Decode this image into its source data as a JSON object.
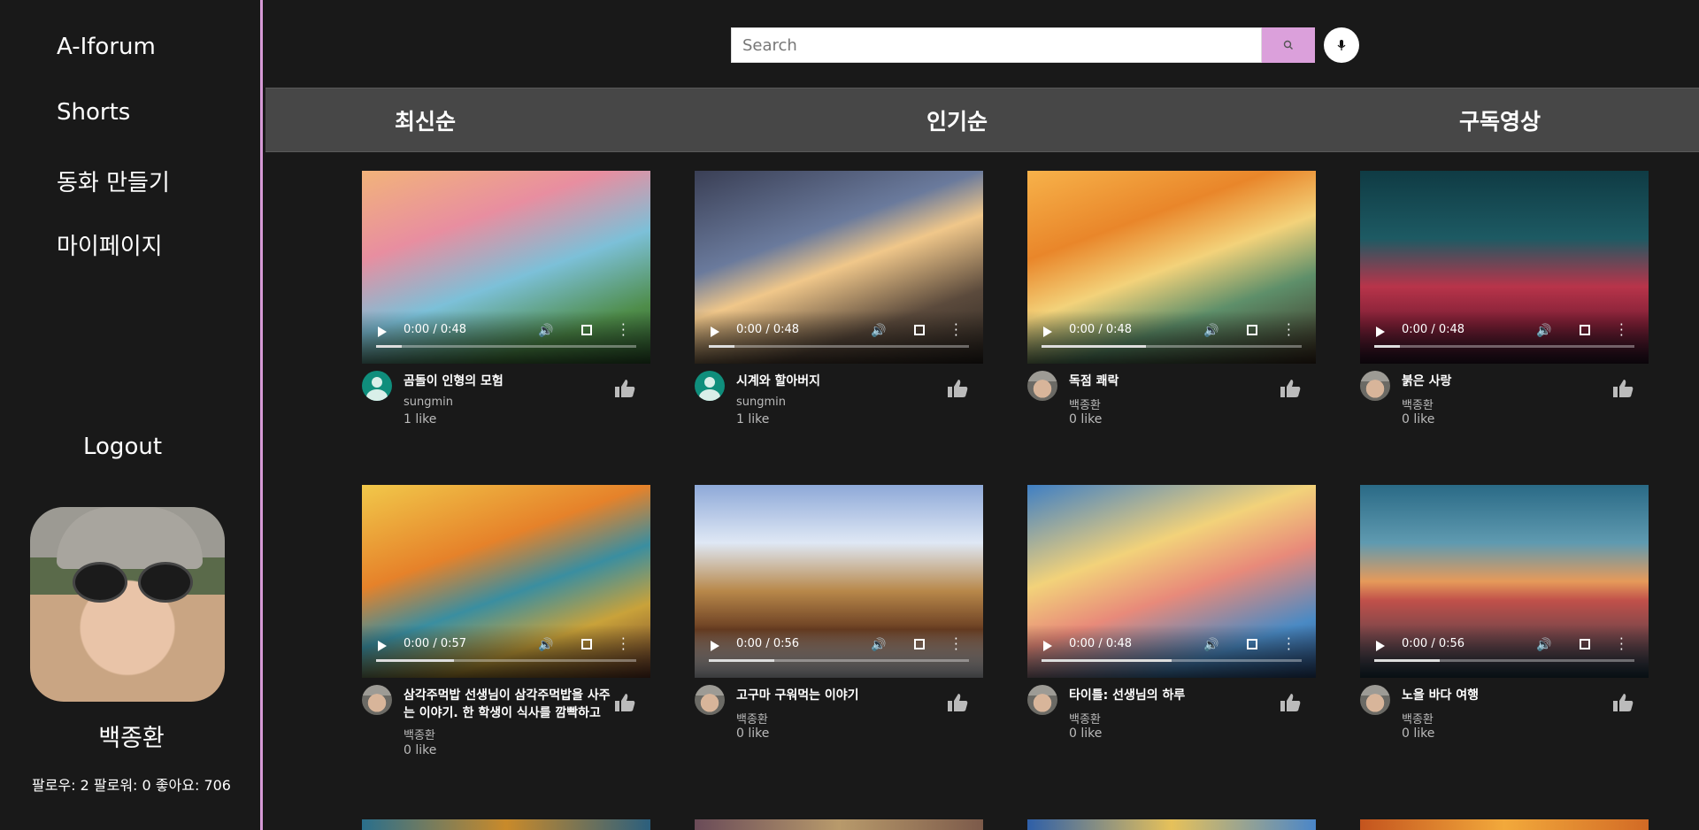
{
  "sidebar": {
    "items": [
      {
        "label": "A-Iforum"
      },
      {
        "label": "Shorts"
      },
      {
        "label": "동화 만들기"
      },
      {
        "label": "마이페이지"
      }
    ],
    "logout_label": "Logout",
    "user_name": "백종환",
    "user_stats": "팔로우: 2 팔로워: 0 좋아요: 706"
  },
  "search": {
    "placeholder": "Search",
    "search_icon": "search-icon",
    "mic_icon": "microphone-icon"
  },
  "tabs": [
    {
      "label": "최신순"
    },
    {
      "label": "인기순"
    },
    {
      "label": "구독영상"
    }
  ],
  "colors": {
    "accent": "#dba0db",
    "tab_bar": "#474747",
    "background": "#191919"
  },
  "videos": [
    {
      "title": "곰돌이 인형의 모험",
      "author": "sungmin",
      "likes": "1 like",
      "time": "0:00 / 0:48",
      "progress": 0.1
    },
    {
      "title": "시계와 할아버지",
      "author": "sungmin",
      "likes": "1 like",
      "time": "0:00 / 0:48",
      "progress": 0.1
    },
    {
      "title": "독점 쾌락",
      "author": "백종환",
      "likes": "0 like",
      "time": "0:00 / 0:48",
      "progress": 0.4
    },
    {
      "title": "붉은 사랑",
      "author": "백종환",
      "likes": "0 like",
      "time": "0:00 / 0:48",
      "progress": 0.1
    },
    {
      "title": "삼각주먹밥 선생님이 삼각주먹밥을 사주는 이야기. 한 학생이 식사를 깜빡하고 집에 …",
      "author": "백종환",
      "likes": "0 like",
      "time": "0:00 / 0:57",
      "progress": 0.3
    },
    {
      "title": "고구마 구워먹는 이야기",
      "author": "백종환",
      "likes": "0 like",
      "time": "0:00 / 0:56",
      "progress": 0.25
    },
    {
      "title": "타이틀: 선생님의 하루",
      "author": "백종환",
      "likes": "0 like",
      "time": "0:00 / 0:48",
      "progress": 0.5
    },
    {
      "title": "노을 바다 여행",
      "author": "백종환",
      "likes": "0 like",
      "time": "0:00 / 0:56",
      "progress": 0.25
    }
  ]
}
